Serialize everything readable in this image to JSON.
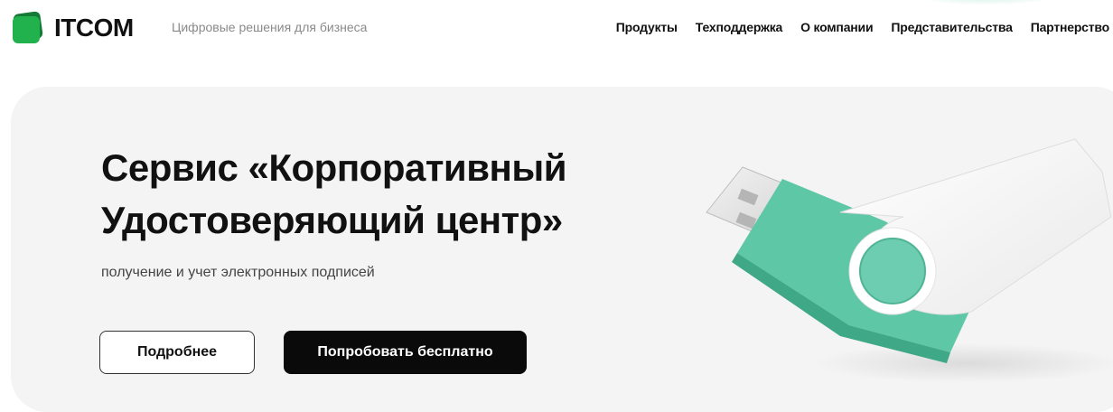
{
  "header": {
    "logo_text": "ITCOM",
    "tagline": "Цифровые решения для бизнеса",
    "nav": [
      {
        "label": "Продукты"
      },
      {
        "label": "Техподдержка"
      },
      {
        "label": "О компании"
      },
      {
        "label": "Представительства"
      },
      {
        "label": "Партнерство"
      }
    ]
  },
  "hero": {
    "title_line1": "Сервис «Корпоративный",
    "title_line2": "Удостоверяющий центр»",
    "subtitle": "получение и учет электронных подписей",
    "btn_more": "Подробнее",
    "btn_try": "Попробовать бесплатно"
  },
  "colors": {
    "brand_green": "#1fae4b",
    "usb_teal": "#5ec7a6",
    "hero_bg": "#f4f4f4",
    "button_dark": "#0a0a0a"
  }
}
